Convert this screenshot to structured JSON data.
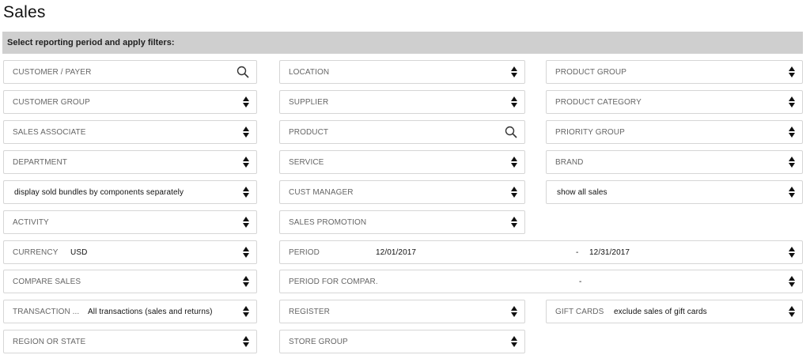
{
  "page": {
    "title": "Sales"
  },
  "filter_bar": {
    "label": "Select reporting period and apply filters:"
  },
  "fields": {
    "customer_payer": "CUSTOMER / PAYER",
    "location": "LOCATION",
    "product_group": "PRODUCT GROUP",
    "customer_group": "CUSTOMER GROUP",
    "supplier": "SUPPLIER",
    "product_category": "PRODUCT CATEGORY",
    "sales_associate": "SALES ASSOCIATE",
    "product": "PRODUCT",
    "priority_group": "PRIORITY GROUP",
    "department": "DEPARTMENT",
    "service": "SERVICE",
    "brand": "BRAND",
    "bundles_value": "display sold bundles by components separately",
    "cust_manager": "CUST MANAGER",
    "show_sales_value": "show all sales",
    "activity": "ACTIVITY",
    "sales_promotion": "SALES PROMOTION",
    "currency_label": "CURRENCY",
    "currency_value": "USD",
    "period_label": "PERIOD",
    "period_from": "12/01/2017",
    "period_sep": "-",
    "period_to": "12/31/2017",
    "compare_sales": "COMPARE SALES",
    "period_compare_label": "PERIOD FOR COMPAR.",
    "period_compare_sep": "-",
    "transaction_label": "TRANSACTION ...",
    "transaction_value": "All transactions (sales and returns)",
    "register": "REGISTER",
    "gift_cards_label": "GIFT CARDS",
    "gift_cards_value": "exclude sales of gift cards",
    "region_state": "REGION OR STATE",
    "store_group": "STORE GROUP"
  },
  "icons": {
    "select": "updown-arrows-icon",
    "search": "search-icon"
  }
}
